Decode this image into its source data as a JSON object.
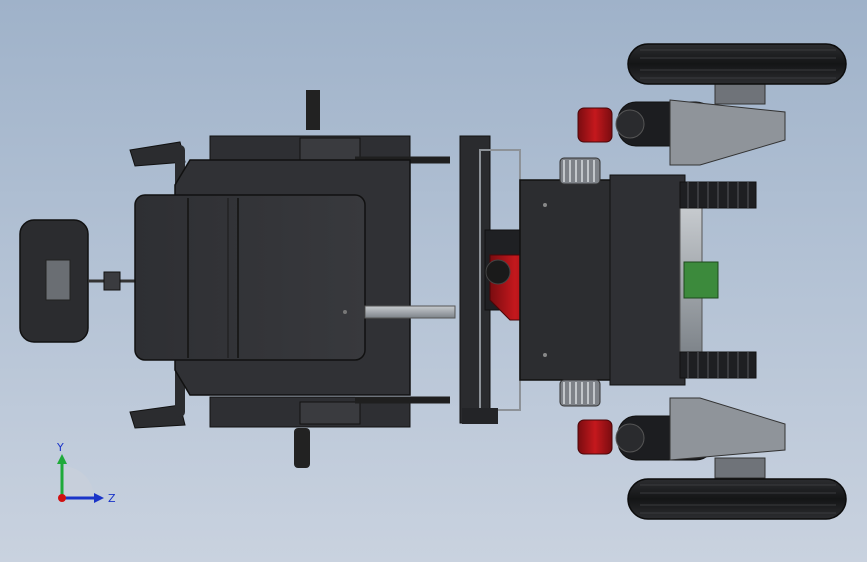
{
  "viewport": {
    "background_top": "#9fb2c9",
    "background_bottom": "#c9d2df"
  },
  "triad": {
    "y_label": "Y",
    "z_label": "Z",
    "y_color": "#1faa3a",
    "z_color": "#1a34c8",
    "origin_color": "#d01010"
  },
  "model": {
    "body_color": "#2b2c2f",
    "tire_color": "#1b1c1e",
    "metal_color": "#9aa0a6",
    "accent_red": "#b0171b",
    "accent_green": "#3c8a3c"
  }
}
